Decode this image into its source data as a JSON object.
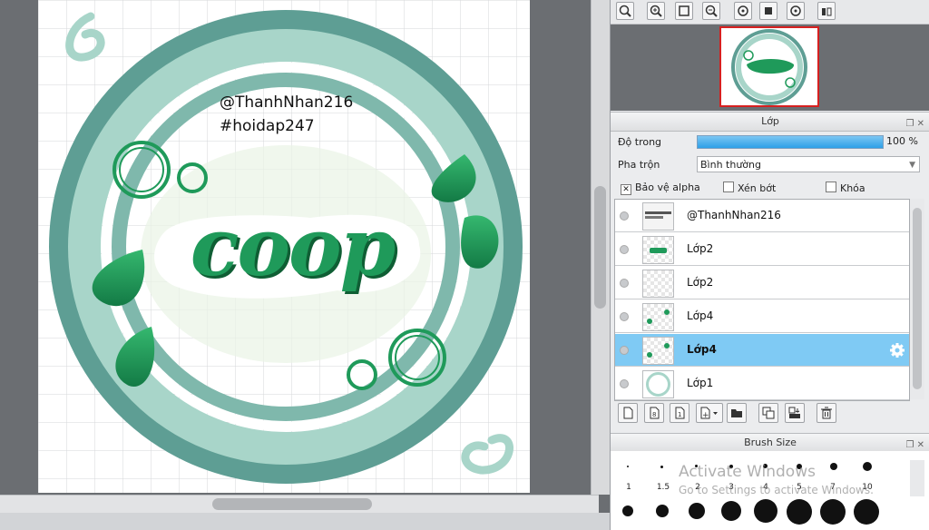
{
  "artwork": {
    "credit_line1": "@ThanhNhan216",
    "credit_line2": "#hoidap247",
    "lettering": "coop"
  },
  "layer_panel": {
    "title": "Lớp",
    "opacity_label": "Độ trong",
    "opacity_value": "100 %",
    "opacity_fraction": 1.0,
    "blend_label": "Pha trộn",
    "blend_value": "Bình thường",
    "protect_alpha_label": "Bảo vệ alpha",
    "protect_alpha_checked": true,
    "clipping_label": "Xén bớt",
    "clipping_checked": false,
    "lock_label": "Khóa",
    "lock_checked": false,
    "layers": [
      {
        "name": "@ThanhNhan216",
        "active": false
      },
      {
        "name": "Lớp2",
        "active": false
      },
      {
        "name": "Lớp2",
        "active": false
      },
      {
        "name": "Lớp4",
        "active": false
      },
      {
        "name": "Lớp4",
        "active": true
      },
      {
        "name": "Lớp1",
        "active": false
      }
    ]
  },
  "brush_panel": {
    "title": "Brush Size",
    "sizes": [
      "1",
      "1.5",
      "2",
      "3",
      "4",
      "5",
      "7",
      "10"
    ]
  },
  "watermark": {
    "line1": "Activate Windows",
    "line2": "Go to Settings to activate Windows."
  },
  "colors": {
    "accent_green": "#1f9a5a",
    "ring_teal": "#5e9e94",
    "ring_light": "#a8d5c9",
    "active_layer": "#7fcaf4"
  }
}
